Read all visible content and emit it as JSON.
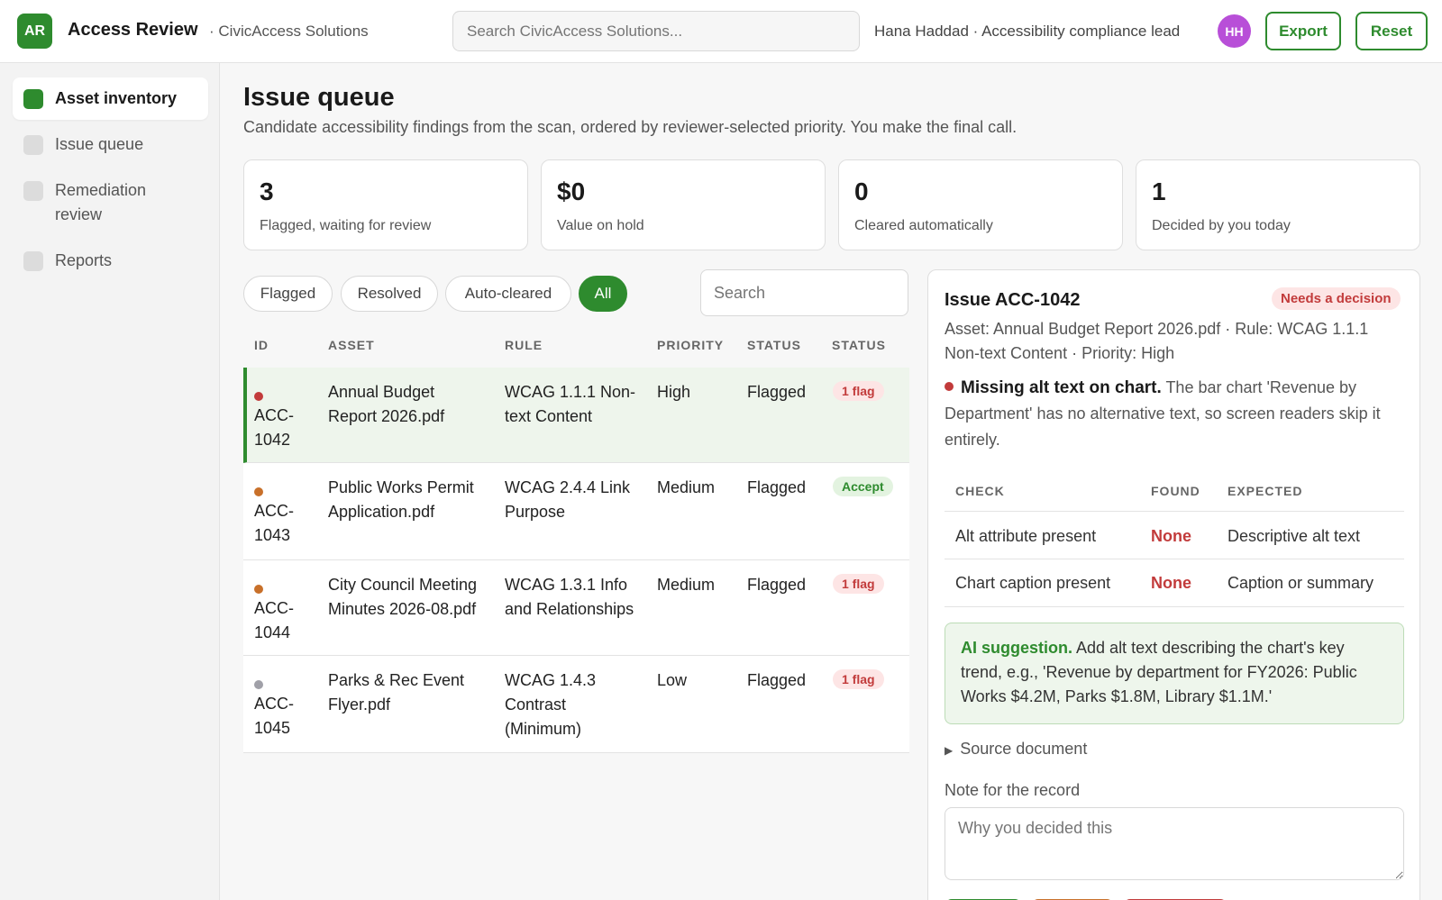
{
  "header": {
    "logo": "AR",
    "app_title": "Access Review",
    "org": "· CivicAccess Solutions",
    "search_placeholder": "Search CivicAccess Solutions...",
    "user_line": "Hana Haddad · Accessibility compliance lead",
    "avatar": "HH",
    "export_label": "Export",
    "reset_label": "Reset"
  },
  "sidebar": {
    "items": [
      {
        "label": "Asset inventory",
        "active": true
      },
      {
        "label": "Issue queue",
        "active": false
      },
      {
        "label": "Remediation review",
        "active": false
      },
      {
        "label": "Reports",
        "active": false
      }
    ]
  },
  "page": {
    "title": "Issue queue",
    "subtitle": "Candidate accessibility findings from the scan, ordered by reviewer-selected priority. You make the final call."
  },
  "stats": [
    {
      "value": "3",
      "label": "Flagged, waiting for review"
    },
    {
      "value": "$0",
      "label": "Value on hold"
    },
    {
      "value": "0",
      "label": "Cleared automatically"
    },
    {
      "value": "1",
      "label": "Decided by you today"
    }
  ],
  "filters": {
    "chips": [
      "Flagged",
      "Resolved",
      "Auto-cleared",
      "All"
    ],
    "active": "All",
    "search_placeholder": "Search"
  },
  "table": {
    "headers": [
      "ID",
      "ASSET",
      "RULE",
      "PRIORITY",
      "STATUS",
      "STATUS"
    ],
    "rows": [
      {
        "id": "ACC-\n1042",
        "asset": "Annual Budget Report 2026.pdf",
        "rule": "WCAG 1.1.1 Non-text Content",
        "priority": "High",
        "status": "Flagged",
        "badge": "1 flag",
        "badge_type": "flag",
        "dot_color": "#c23b3b",
        "selected": true
      },
      {
        "id": "ACC-\n1043",
        "asset": "Public Works Permit Application.pdf",
        "rule": "WCAG 2.4.4 Link Purpose",
        "priority": "Medium",
        "status": "Flagged",
        "badge": "Accept",
        "badge_type": "accept",
        "dot_color": "#c8702a",
        "selected": false
      },
      {
        "id": "ACC-\n1044",
        "asset": "City Council Meeting Minutes 2026-08.pdf",
        "rule": "WCAG 1.3.1 Info and Relationships",
        "priority": "Medium",
        "status": "Flagged",
        "badge": "1 flag",
        "badge_type": "flag",
        "dot_color": "#c8702a",
        "selected": false
      },
      {
        "id": "ACC-\n1045",
        "asset": "Parks & Rec Event Flyer.pdf",
        "rule": "WCAG 1.4.3 Contrast (Minimum)",
        "priority": "Low",
        "status": "Flagged",
        "badge": "1 flag",
        "badge_type": "flag",
        "dot_color": "#a0a0a8",
        "selected": false
      }
    ]
  },
  "detail": {
    "title": "Issue ACC-1042",
    "pill": "Needs a decision",
    "meta": "Asset: Annual Budget Report 2026.pdf · Rule: WCAG 1.1.1 Non-text Content · Priority: High",
    "desc_bold": "Missing alt text on chart.",
    "desc_rest": " The bar chart 'Revenue by Department' has no alternative text, so screen readers skip it entirely.",
    "check_headers": [
      "CHECK",
      "FOUND",
      "EXPECTED"
    ],
    "checks": [
      {
        "check": "Alt attribute present",
        "found": "None",
        "expected": "Descriptive alt text"
      },
      {
        "check": "Chart caption present",
        "found": "None",
        "expected": "Caption or summary"
      }
    ],
    "ai_label": "AI suggestion.",
    "ai_text": " Add alt text describing the chart's key trend, e.g., 'Revenue by department for FY2026: Public Works $4.2M, Parks $1.8M, Library $1.1M.'",
    "source_label": "Source document",
    "note_label": "Note for the record",
    "note_placeholder": "Why you decided this"
  },
  "colors": {
    "accent": "#2e8b2e",
    "danger": "#c23b3b",
    "avatar": "#b84fd8",
    "medium": "#c8702a",
    "low": "#a0a0a8"
  }
}
